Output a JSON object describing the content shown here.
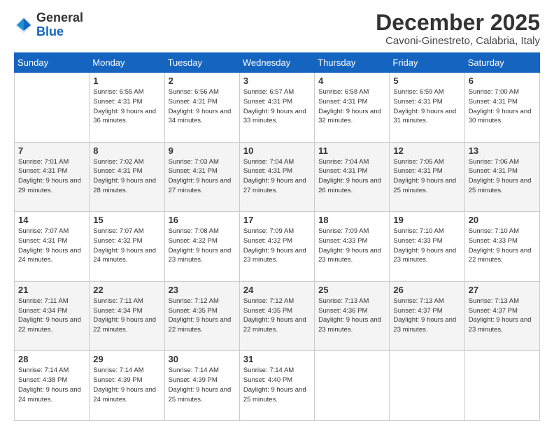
{
  "header": {
    "logo": {
      "general": "General",
      "blue": "Blue"
    },
    "month": "December 2025",
    "location": "Cavoni-Ginestreto, Calabria, Italy"
  },
  "weekdays": [
    "Sunday",
    "Monday",
    "Tuesday",
    "Wednesday",
    "Thursday",
    "Friday",
    "Saturday"
  ],
  "weeks": [
    [
      {
        "day": "",
        "sunrise": "",
        "sunset": "",
        "daylight": ""
      },
      {
        "day": "1",
        "sunrise": "Sunrise: 6:55 AM",
        "sunset": "Sunset: 4:31 PM",
        "daylight": "Daylight: 9 hours and 36 minutes."
      },
      {
        "day": "2",
        "sunrise": "Sunrise: 6:56 AM",
        "sunset": "Sunset: 4:31 PM",
        "daylight": "Daylight: 9 hours and 34 minutes."
      },
      {
        "day": "3",
        "sunrise": "Sunrise: 6:57 AM",
        "sunset": "Sunset: 4:31 PM",
        "daylight": "Daylight: 9 hours and 33 minutes."
      },
      {
        "day": "4",
        "sunrise": "Sunrise: 6:58 AM",
        "sunset": "Sunset: 4:31 PM",
        "daylight": "Daylight: 9 hours and 32 minutes."
      },
      {
        "day": "5",
        "sunrise": "Sunrise: 6:59 AM",
        "sunset": "Sunset: 4:31 PM",
        "daylight": "Daylight: 9 hours and 31 minutes."
      },
      {
        "day": "6",
        "sunrise": "Sunrise: 7:00 AM",
        "sunset": "Sunset: 4:31 PM",
        "daylight": "Daylight: 9 hours and 30 minutes."
      }
    ],
    [
      {
        "day": "7",
        "sunrise": "Sunrise: 7:01 AM",
        "sunset": "Sunset: 4:31 PM",
        "daylight": "Daylight: 9 hours and 29 minutes."
      },
      {
        "day": "8",
        "sunrise": "Sunrise: 7:02 AM",
        "sunset": "Sunset: 4:31 PM",
        "daylight": "Daylight: 9 hours and 28 minutes."
      },
      {
        "day": "9",
        "sunrise": "Sunrise: 7:03 AM",
        "sunset": "Sunset: 4:31 PM",
        "daylight": "Daylight: 9 hours and 27 minutes."
      },
      {
        "day": "10",
        "sunrise": "Sunrise: 7:04 AM",
        "sunset": "Sunset: 4:31 PM",
        "daylight": "Daylight: 9 hours and 27 minutes."
      },
      {
        "day": "11",
        "sunrise": "Sunrise: 7:04 AM",
        "sunset": "Sunset: 4:31 PM",
        "daylight": "Daylight: 9 hours and 26 minutes."
      },
      {
        "day": "12",
        "sunrise": "Sunrise: 7:05 AM",
        "sunset": "Sunset: 4:31 PM",
        "daylight": "Daylight: 9 hours and 25 minutes."
      },
      {
        "day": "13",
        "sunrise": "Sunrise: 7:06 AM",
        "sunset": "Sunset: 4:31 PM",
        "daylight": "Daylight: 9 hours and 25 minutes."
      }
    ],
    [
      {
        "day": "14",
        "sunrise": "Sunrise: 7:07 AM",
        "sunset": "Sunset: 4:31 PM",
        "daylight": "Daylight: 9 hours and 24 minutes."
      },
      {
        "day": "15",
        "sunrise": "Sunrise: 7:07 AM",
        "sunset": "Sunset: 4:32 PM",
        "daylight": "Daylight: 9 hours and 24 minutes."
      },
      {
        "day": "16",
        "sunrise": "Sunrise: 7:08 AM",
        "sunset": "Sunset: 4:32 PM",
        "daylight": "Daylight: 9 hours and 23 minutes."
      },
      {
        "day": "17",
        "sunrise": "Sunrise: 7:09 AM",
        "sunset": "Sunset: 4:32 PM",
        "daylight": "Daylight: 9 hours and 23 minutes."
      },
      {
        "day": "18",
        "sunrise": "Sunrise: 7:09 AM",
        "sunset": "Sunset: 4:33 PM",
        "daylight": "Daylight: 9 hours and 23 minutes."
      },
      {
        "day": "19",
        "sunrise": "Sunrise: 7:10 AM",
        "sunset": "Sunset: 4:33 PM",
        "daylight": "Daylight: 9 hours and 23 minutes."
      },
      {
        "day": "20",
        "sunrise": "Sunrise: 7:10 AM",
        "sunset": "Sunset: 4:33 PM",
        "daylight": "Daylight: 9 hours and 22 minutes."
      }
    ],
    [
      {
        "day": "21",
        "sunrise": "Sunrise: 7:11 AM",
        "sunset": "Sunset: 4:34 PM",
        "daylight": "Daylight: 9 hours and 22 minutes."
      },
      {
        "day": "22",
        "sunrise": "Sunrise: 7:11 AM",
        "sunset": "Sunset: 4:34 PM",
        "daylight": "Daylight: 9 hours and 22 minutes."
      },
      {
        "day": "23",
        "sunrise": "Sunrise: 7:12 AM",
        "sunset": "Sunset: 4:35 PM",
        "daylight": "Daylight: 9 hours and 22 minutes."
      },
      {
        "day": "24",
        "sunrise": "Sunrise: 7:12 AM",
        "sunset": "Sunset: 4:35 PM",
        "daylight": "Daylight: 9 hours and 22 minutes."
      },
      {
        "day": "25",
        "sunrise": "Sunrise: 7:13 AM",
        "sunset": "Sunset: 4:36 PM",
        "daylight": "Daylight: 9 hours and 23 minutes."
      },
      {
        "day": "26",
        "sunrise": "Sunrise: 7:13 AM",
        "sunset": "Sunset: 4:37 PM",
        "daylight": "Daylight: 9 hours and 23 minutes."
      },
      {
        "day": "27",
        "sunrise": "Sunrise: 7:13 AM",
        "sunset": "Sunset: 4:37 PM",
        "daylight": "Daylight: 9 hours and 23 minutes."
      }
    ],
    [
      {
        "day": "28",
        "sunrise": "Sunrise: 7:14 AM",
        "sunset": "Sunset: 4:38 PM",
        "daylight": "Daylight: 9 hours and 24 minutes."
      },
      {
        "day": "29",
        "sunrise": "Sunrise: 7:14 AM",
        "sunset": "Sunset: 4:39 PM",
        "daylight": "Daylight: 9 hours and 24 minutes."
      },
      {
        "day": "30",
        "sunrise": "Sunrise: 7:14 AM",
        "sunset": "Sunset: 4:39 PM",
        "daylight": "Daylight: 9 hours and 25 minutes."
      },
      {
        "day": "31",
        "sunrise": "Sunrise: 7:14 AM",
        "sunset": "Sunset: 4:40 PM",
        "daylight": "Daylight: 9 hours and 25 minutes."
      },
      {
        "day": "",
        "sunrise": "",
        "sunset": "",
        "daylight": ""
      },
      {
        "day": "",
        "sunrise": "",
        "sunset": "",
        "daylight": ""
      },
      {
        "day": "",
        "sunrise": "",
        "sunset": "",
        "daylight": ""
      }
    ]
  ]
}
